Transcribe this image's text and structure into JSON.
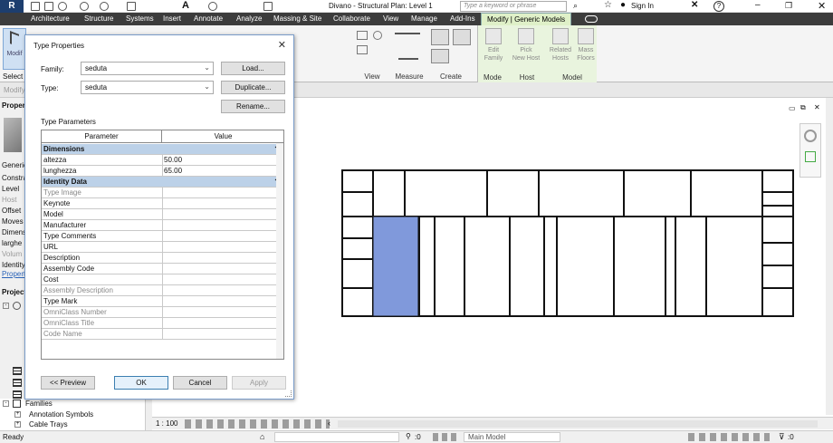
{
  "app": {
    "title": "Divano - Structural Plan: Level 1",
    "search_placeholder": "Type a keyword or phrase",
    "sign_in": "Sign In",
    "logo": "R"
  },
  "tabs": [
    "Architecture",
    "Structure",
    "Systems",
    "Insert",
    "Annotate",
    "Analyze",
    "Massing & Site",
    "Collaborate",
    "View",
    "Manage",
    "Add-Ins",
    "Modify | Generic Models"
  ],
  "ribbon": {
    "select_label": "Select",
    "modify_label": "Modif",
    "groups": {
      "view": "View",
      "measure": "Measure",
      "create": "Create",
      "mode": "Mode",
      "host": "Host",
      "model": "Model"
    },
    "buttons": {
      "edit_family": "Edit\nFamily",
      "pick_new_host": "Pick\nNew Host",
      "related_hosts": "Related\nHosts",
      "mass_floors": "Mass\nFloors"
    }
  },
  "option_bar": {
    "modify": "Modify"
  },
  "left_panel": {
    "items": [
      "Properti",
      "Generic",
      "Constra",
      "Level",
      "Host",
      "Offset",
      "Moves",
      "Dimens",
      "larghe",
      "Volum",
      "Identity",
      "Properti",
      "Project B"
    ]
  },
  "browser": {
    "families": "Families",
    "annotation_symbols": "Annotation Symbols",
    "cable_trays": "Cable Trays"
  },
  "view_bar": {
    "scale": "1 : 100"
  },
  "status_bar": {
    "status": "Ready",
    "selection_count": ":0",
    "model": "Main Model",
    "filter_count": ":0"
  },
  "dialog": {
    "title": "Type Properties",
    "family_label": "Family:",
    "family_value": "seduta",
    "type_label": "Type:",
    "type_value": "seduta",
    "load_button": "Load...",
    "duplicate_button": "Duplicate...",
    "rename_button": "Rename...",
    "type_parameters_label": "Type Parameters",
    "columns": {
      "parameter": "Parameter",
      "value": "Value"
    },
    "groups": [
      {
        "name": "Dimensions",
        "rows": [
          {
            "param": "altezza",
            "value": "50.00",
            "disabled": false
          },
          {
            "param": "lunghezza",
            "value": "65.00",
            "disabled": false
          }
        ]
      },
      {
        "name": "Identity Data",
        "rows": [
          {
            "param": "Type Image",
            "value": "",
            "disabled": true
          },
          {
            "param": "Keynote",
            "value": "",
            "disabled": false
          },
          {
            "param": "Model",
            "value": "",
            "disabled": false
          },
          {
            "param": "Manufacturer",
            "value": "",
            "disabled": false
          },
          {
            "param": "Type Comments",
            "value": "",
            "disabled": false
          },
          {
            "param": "URL",
            "value": "",
            "disabled": false
          },
          {
            "param": "Description",
            "value": "",
            "disabled": false
          },
          {
            "param": "Assembly Code",
            "value": "",
            "disabled": false
          },
          {
            "param": "Cost",
            "value": "",
            "disabled": false
          },
          {
            "param": "Assembly Description",
            "value": "",
            "disabled": true
          },
          {
            "param": "Type Mark",
            "value": "",
            "disabled": false
          },
          {
            "param": "OmniClass Number",
            "value": "",
            "disabled": true
          },
          {
            "param": "OmniClass Title",
            "value": "",
            "disabled": true
          },
          {
            "param": "Code Name",
            "value": "",
            "disabled": true
          }
        ]
      }
    ],
    "preview_button": "<< Preview",
    "ok_button": "OK",
    "cancel_button": "Cancel",
    "apply_button": "Apply"
  },
  "colors": {
    "selected_element": "#8099db",
    "tab_active": "#dff0c8",
    "group_header": "#bcd1e8"
  }
}
